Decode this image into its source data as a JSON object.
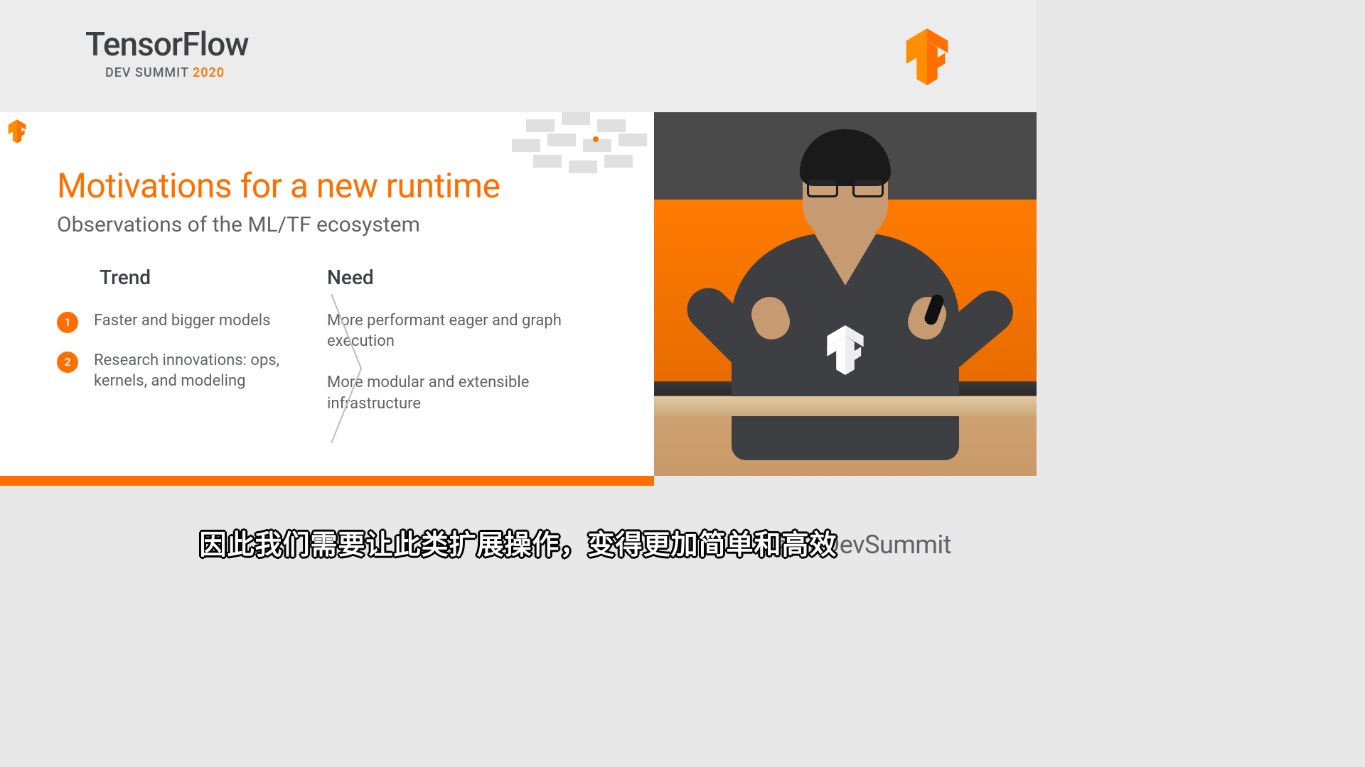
{
  "header": {
    "brand_main": "TensorFlow",
    "brand_sub_prefix": "DEV SUMMIT ",
    "brand_sub_year": "2020"
  },
  "slide": {
    "title": "Motivations for a new runtime",
    "subtitle": "Observations of the ML/TF ecosystem",
    "trend_heading": "Trend",
    "need_heading": "Need",
    "trends": [
      {
        "num": "1",
        "text": "Faster and bigger models"
      },
      {
        "num": "2",
        "text": "Research innovations: ops, kernels, and modeling"
      }
    ],
    "needs": [
      {
        "text": "More performant eager and graph execution"
      },
      {
        "text": "More modular and extensible infrastructure"
      }
    ]
  },
  "lower": {
    "hashtag": "#TFDevSummit",
    "caption": "因此我们需要让此类扩展操作，变得更加简单和高效"
  }
}
